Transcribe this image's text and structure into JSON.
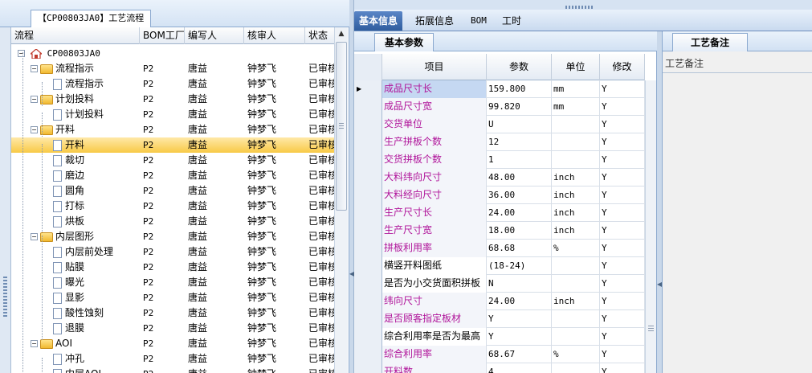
{
  "left_panel": {
    "title_tab": "【CP00803JA0】工艺流程",
    "columns": [
      "流程",
      "BOM工厂",
      "编写人",
      "核审人",
      "状态"
    ],
    "root_label": "CP00803JA0",
    "rows": [
      {
        "name": "流程指示",
        "kind": "folder",
        "bom": "P2",
        "author": "唐益",
        "reviewer": "钟梦飞",
        "status": "已审核"
      },
      {
        "name": "流程指示",
        "kind": "leaf",
        "bom": "P2",
        "author": "唐益",
        "reviewer": "钟梦飞",
        "status": "已审核"
      },
      {
        "name": "计划投料",
        "kind": "folder",
        "bom": "P2",
        "author": "唐益",
        "reviewer": "钟梦飞",
        "status": "已审核"
      },
      {
        "name": "计划投料",
        "kind": "leaf",
        "bom": "P2",
        "author": "唐益",
        "reviewer": "钟梦飞",
        "status": "已审核"
      },
      {
        "name": "开料",
        "kind": "folder",
        "bom": "P2",
        "author": "唐益",
        "reviewer": "钟梦飞",
        "status": "已审核"
      },
      {
        "name": "开料",
        "kind": "leaf",
        "bom": "P2",
        "author": "唐益",
        "reviewer": "钟梦飞",
        "status": "已审核",
        "selected": true
      },
      {
        "name": "裁切",
        "kind": "leaf",
        "bom": "P2",
        "author": "唐益",
        "reviewer": "钟梦飞",
        "status": "已审核"
      },
      {
        "name": "磨边",
        "kind": "leaf",
        "bom": "P2",
        "author": "唐益",
        "reviewer": "钟梦飞",
        "status": "已审核"
      },
      {
        "name": "圆角",
        "kind": "leaf",
        "bom": "P2",
        "author": "唐益",
        "reviewer": "钟梦飞",
        "status": "已审核"
      },
      {
        "name": "打标",
        "kind": "leaf",
        "bom": "P2",
        "author": "唐益",
        "reviewer": "钟梦飞",
        "status": "已审核"
      },
      {
        "name": "烘板",
        "kind": "leaf",
        "bom": "P2",
        "author": "唐益",
        "reviewer": "钟梦飞",
        "status": "已审核"
      },
      {
        "name": "内层图形",
        "kind": "folder",
        "bom": "P2",
        "author": "唐益",
        "reviewer": "钟梦飞",
        "status": "已审核"
      },
      {
        "name": "内层前处理",
        "kind": "leaf",
        "bom": "P2",
        "author": "唐益",
        "reviewer": "钟梦飞",
        "status": "已审核"
      },
      {
        "name": "贴膜",
        "kind": "leaf",
        "bom": "P2",
        "author": "唐益",
        "reviewer": "钟梦飞",
        "status": "已审核"
      },
      {
        "name": "曝光",
        "kind": "leaf",
        "bom": "P2",
        "author": "唐益",
        "reviewer": "钟梦飞",
        "status": "已审核"
      },
      {
        "name": "显影",
        "kind": "leaf",
        "bom": "P2",
        "author": "唐益",
        "reviewer": "钟梦飞",
        "status": "已审核"
      },
      {
        "name": "酸性蚀刻",
        "kind": "leaf",
        "bom": "P2",
        "author": "唐益",
        "reviewer": "钟梦飞",
        "status": "已审核"
      },
      {
        "name": "退膜",
        "kind": "leaf",
        "bom": "P2",
        "author": "唐益",
        "reviewer": "钟梦飞",
        "status": "已审核"
      },
      {
        "name": "AOI",
        "kind": "folder",
        "bom": "P2",
        "author": "唐益",
        "reviewer": "钟梦飞",
        "status": "已审核"
      },
      {
        "name": "冲孔",
        "kind": "leaf",
        "bom": "P2",
        "author": "唐益",
        "reviewer": "钟梦飞",
        "status": "已审核"
      },
      {
        "name": "内层AOI",
        "kind": "leaf",
        "bom": "P2",
        "author": "唐益",
        "reviewer": "钟梦飞",
        "status": "已审核"
      }
    ]
  },
  "top_tabs": [
    "基本信息",
    "拓展信息",
    "BOM",
    "工时"
  ],
  "center_panel": {
    "sub_tab": "基本参数",
    "columns": [
      "项目",
      "参数",
      "单位",
      "修改"
    ],
    "rows": [
      {
        "item": "成品尺寸长",
        "value": "159.800",
        "unit": "mm",
        "edit": "Y",
        "current": true
      },
      {
        "item": "成品尺寸宽",
        "value": "99.820",
        "unit": "mm",
        "edit": "Y"
      },
      {
        "item": "交货单位",
        "value": "U",
        "unit": "",
        "edit": "Y"
      },
      {
        "item": "生产拼板个数",
        "value": "12",
        "unit": "",
        "edit": "Y"
      },
      {
        "item": "交货拼板个数",
        "value": "1",
        "unit": "",
        "edit": "Y"
      },
      {
        "item": "大料纬向尺寸",
        "value": "48.00",
        "unit": "inch",
        "edit": "Y"
      },
      {
        "item": "大料经向尺寸",
        "value": "36.00",
        "unit": "inch",
        "edit": "Y"
      },
      {
        "item": "生产尺寸长",
        "value": "24.00",
        "unit": "inch",
        "edit": "Y"
      },
      {
        "item": "生产尺寸宽",
        "value": "18.00",
        "unit": "inch",
        "edit": "Y"
      },
      {
        "item": "拼板利用率",
        "value": "68.68",
        "unit": "%",
        "edit": "Y"
      },
      {
        "item": "横竖开料图纸",
        "value": "(18-24)",
        "unit": "",
        "edit": "Y",
        "plain": true
      },
      {
        "item": "是否为小交货面积拼板",
        "value": "N",
        "unit": "",
        "edit": "Y",
        "plain": true
      },
      {
        "item": "纬向尺寸",
        "value": "24.00",
        "unit": "inch",
        "edit": "Y"
      },
      {
        "item": "是否顾客指定板材",
        "value": "Y",
        "unit": "",
        "edit": "Y"
      },
      {
        "item": "综合利用率是否为最高",
        "value": "Y",
        "unit": "",
        "edit": "Y",
        "plain": true
      },
      {
        "item": "综合利用率",
        "value": "68.67",
        "unit": "%",
        "edit": "Y"
      },
      {
        "item": "开料数",
        "value": "4",
        "unit": "",
        "edit": "Y"
      }
    ]
  },
  "right_panel": {
    "tab": "工艺备注",
    "label": "工艺备注"
  },
  "icons": {
    "root": "home-icon",
    "folder": "folder-icon",
    "leaf": "document-icon",
    "row_indicator": "play-arrow-icon"
  },
  "colors": {
    "item_text": "#b0149a",
    "selection": "#f8c946",
    "active_tab": "#2f5d9e"
  }
}
